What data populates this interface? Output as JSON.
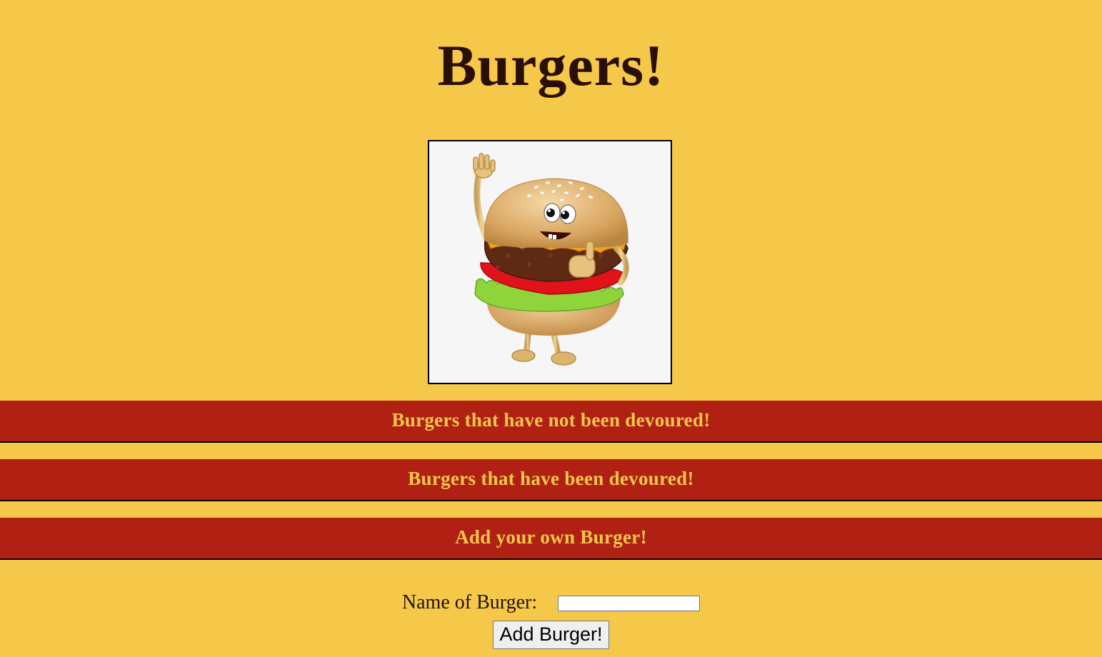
{
  "header": {
    "title": "Burgers!"
  },
  "mascot": {
    "alt": "Smiling cartoon burger waving"
  },
  "sections": [
    {
      "heading": "Burgers that have not been devoured!"
    },
    {
      "heading": "Burgers that have been devoured!"
    },
    {
      "heading": "Add your own Burger!"
    }
  ],
  "form": {
    "name_label": "Name of Burger:",
    "name_value": "",
    "submit_label": "Add Burger!"
  },
  "colors": {
    "background": "#f5c84a",
    "banner": "#b02013",
    "banner_text": "#f5c84a",
    "title_text": "#2a0f08"
  }
}
